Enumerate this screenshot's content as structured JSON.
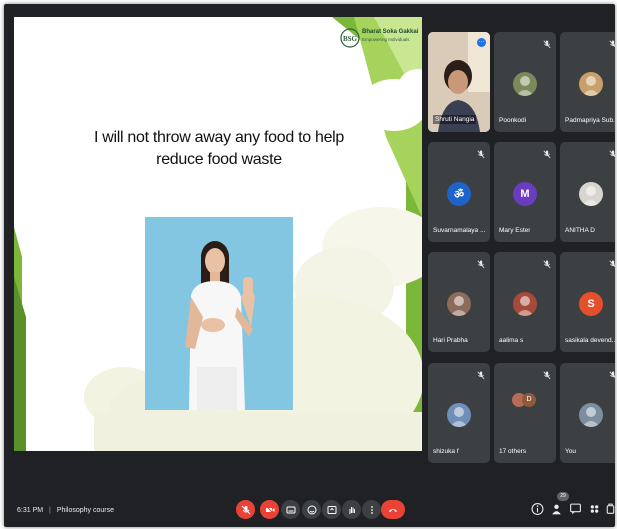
{
  "slide": {
    "title_line1": "I will not throw away any food to help",
    "title_line2": "reduce food waste",
    "logo_name": "Bharat Soka Gakkai",
    "logo_tagline": "Empowering Individuals",
    "logo_mark": "BSG"
  },
  "participants": [
    {
      "name": "Shruti Nangia",
      "avatar": "photo",
      "highlight": true
    },
    {
      "name": "Poonkodi",
      "avatar": "photo"
    },
    {
      "name": "Padmapriya Sub...",
      "avatar": "photo"
    },
    {
      "name": "Suvarnamalaya ...",
      "avatar": "om-symbol"
    },
    {
      "name": "Mary Ester",
      "avatar": "letter",
      "letter": "M",
      "color": "#6a3dc0"
    },
    {
      "name": "ANITHA D",
      "avatar": "photo"
    },
    {
      "name": "Hari Prabha",
      "avatar": "photo"
    },
    {
      "name": "aalima s",
      "avatar": "photo"
    },
    {
      "name": "sasikala devend...",
      "avatar": "letter",
      "letter": "S",
      "color": "#e4502b"
    },
    {
      "name": "shizuka f",
      "avatar": "photo"
    },
    {
      "name": "17 others",
      "avatar": "group",
      "letter": "D"
    },
    {
      "name": "You",
      "avatar": "photo"
    }
  ],
  "bottom_bar": {
    "time": "6:31 PM",
    "separator": "|",
    "meeting_name": "Philosophy course",
    "participant_count": "29"
  },
  "colors": {
    "background": "#202124",
    "tile": "#3c4043",
    "danger": "#ea4335",
    "slide_green": "#7bb83a"
  }
}
